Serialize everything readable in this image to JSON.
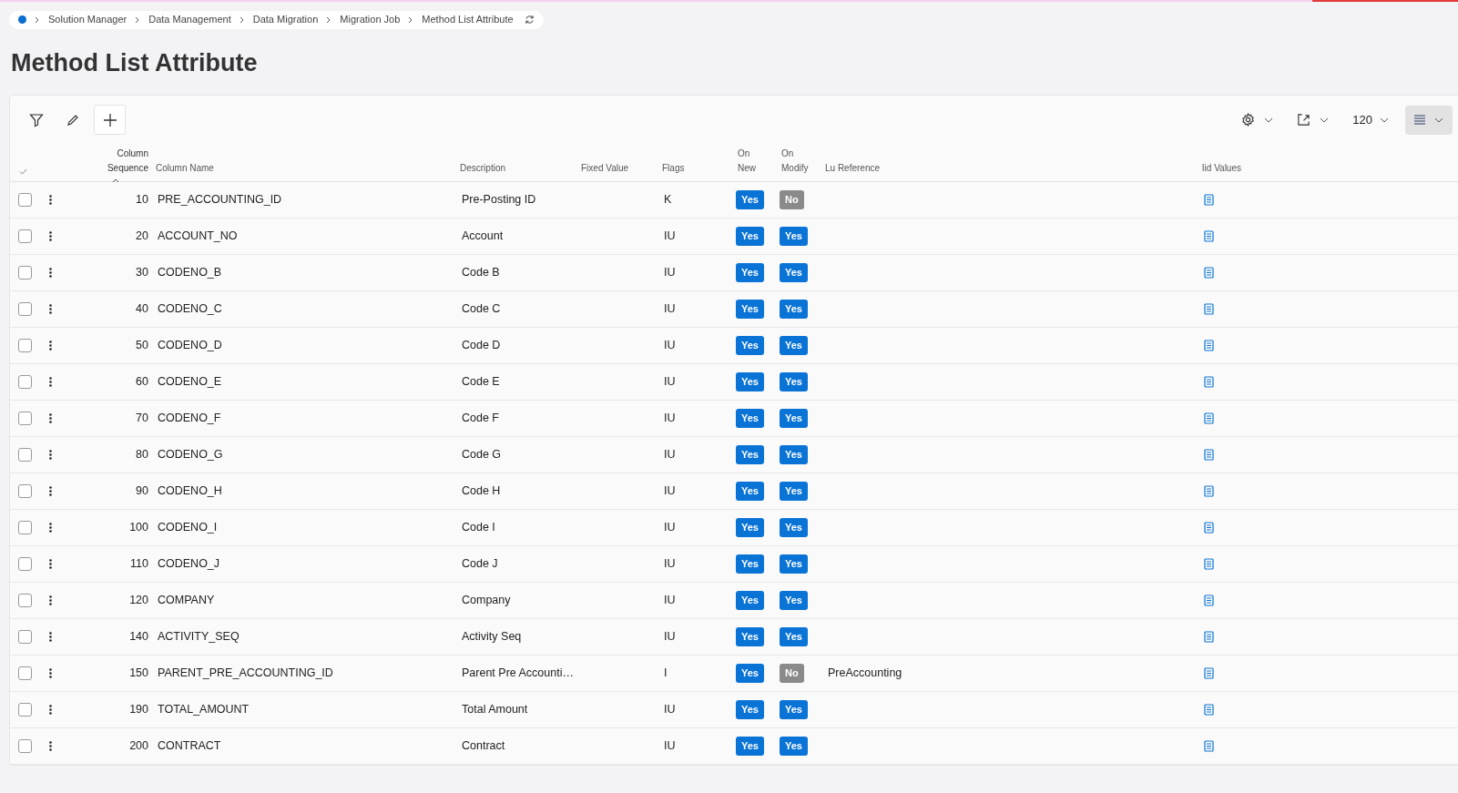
{
  "breadcrumb": [
    "Solution Manager",
    "Data Management",
    "Data Migration",
    "Migration Job",
    "Method List Attribute"
  ],
  "title": "Method List Attribute",
  "toolbar": {
    "page_size": "120"
  },
  "table": {
    "columns": [
      {
        "label": "Column Sequence",
        "sorted": true
      },
      {
        "label": "Column Name",
        "sorted": false
      },
      {
        "label": "Description",
        "sorted": false
      },
      {
        "label": "Fixed Value",
        "sorted": false
      },
      {
        "label": "Flags",
        "sorted": false
      },
      {
        "label": "On New",
        "sorted": false
      },
      {
        "label": "On Modify",
        "sorted": false
      },
      {
        "label": "Lu Reference",
        "sorted": false
      },
      {
        "label": "Iid Values",
        "sorted": false
      }
    ],
    "rows": [
      {
        "selected": false,
        "seq": "10",
        "name": "PRE_ACCOUNTING_ID",
        "desc": "Pre-Posting ID",
        "flags": "K",
        "on_new": {
          "label": "Yes",
          "value": true
        },
        "on_modify": {
          "label": "No",
          "value": false
        }
      },
      {
        "selected": false,
        "seq": "20",
        "name": "ACCOUNT_NO",
        "desc": "Account",
        "flags": "IU",
        "on_new": {
          "label": "Yes",
          "value": true
        },
        "on_modify": {
          "label": "Yes",
          "value": true
        }
      },
      {
        "selected": false,
        "seq": "30",
        "name": "CODENO_B",
        "desc": "Code B",
        "flags": "IU",
        "on_new": {
          "label": "Yes",
          "value": true
        },
        "on_modify": {
          "label": "Yes",
          "value": true
        }
      },
      {
        "selected": false,
        "seq": "40",
        "name": "CODENO_C",
        "desc": "Code C",
        "flags": "IU",
        "on_new": {
          "label": "Yes",
          "value": true
        },
        "on_modify": {
          "label": "Yes",
          "value": true
        }
      },
      {
        "selected": false,
        "seq": "50",
        "name": "CODENO_D",
        "desc": "Code D",
        "flags": "IU",
        "on_new": {
          "label": "Yes",
          "value": true
        },
        "on_modify": {
          "label": "Yes",
          "value": true
        }
      },
      {
        "selected": false,
        "seq": "60",
        "name": "CODENO_E",
        "desc": "Code E",
        "flags": "IU",
        "on_new": {
          "label": "Yes",
          "value": true
        },
        "on_modify": {
          "label": "Yes",
          "value": true
        }
      },
      {
        "selected": false,
        "seq": "70",
        "name": "CODENO_F",
        "desc": "Code F",
        "flags": "IU",
        "on_new": {
          "label": "Yes",
          "value": true
        },
        "on_modify": {
          "label": "Yes",
          "value": true
        }
      },
      {
        "selected": false,
        "seq": "80",
        "name": "CODENO_G",
        "desc": "Code G",
        "flags": "IU",
        "on_new": {
          "label": "Yes",
          "value": true
        },
        "on_modify": {
          "label": "Yes",
          "value": true
        }
      },
      {
        "selected": false,
        "seq": "90",
        "name": "CODENO_H",
        "desc": "Code H",
        "flags": "IU",
        "on_new": {
          "label": "Yes",
          "value": true
        },
        "on_modify": {
          "label": "Yes",
          "value": true
        }
      },
      {
        "selected": false,
        "seq": "100",
        "name": "CODENO_I",
        "desc": "Code I",
        "flags": "IU",
        "on_new": {
          "label": "Yes",
          "value": true
        },
        "on_modify": {
          "label": "Yes",
          "value": true
        }
      },
      {
        "selected": false,
        "seq": "110",
        "name": "CODENO_J",
        "desc": "Code J",
        "flags": "IU",
        "on_new": {
          "label": "Yes",
          "value": true
        },
        "on_modify": {
          "label": "Yes",
          "value": true
        }
      },
      {
        "selected": false,
        "seq": "120",
        "name": "COMPANY",
        "desc": "Company",
        "flags": "IU",
        "on_new": {
          "label": "Yes",
          "value": true
        },
        "on_modify": {
          "label": "Yes",
          "value": true
        }
      },
      {
        "selected": false,
        "seq": "140",
        "name": "ACTIVITY_SEQ",
        "desc": "Activity Seq",
        "flags": "IU",
        "on_new": {
          "label": "Yes",
          "value": true
        },
        "on_modify": {
          "label": "Yes",
          "value": true
        }
      },
      {
        "selected": false,
        "seq": "150",
        "name": "PARENT_PRE_ACCOUNTING_ID",
        "desc": "Parent Pre Accounti…",
        "flags": "I",
        "on_new": {
          "label": "Yes",
          "value": true
        },
        "on_modify": {
          "label": "No",
          "value": false
        },
        "lu": "PreAccounting"
      },
      {
        "selected": false,
        "seq": "190",
        "name": "TOTAL_AMOUNT",
        "desc": "Total Amount",
        "flags": "IU",
        "on_new": {
          "label": "Yes",
          "value": true
        },
        "on_modify": {
          "label": "Yes",
          "value": true
        }
      },
      {
        "selected": false,
        "seq": "200",
        "name": "CONTRACT",
        "desc": "Contract",
        "flags": "IU",
        "on_new": {
          "label": "Yes",
          "value": true
        },
        "on_modify": {
          "label": "Yes",
          "value": true
        }
      }
    ]
  }
}
